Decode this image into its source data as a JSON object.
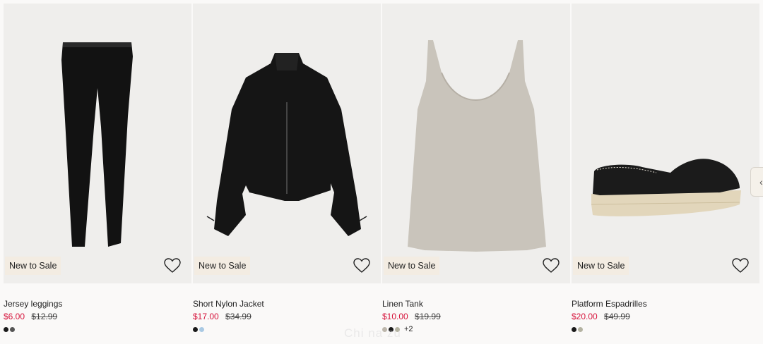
{
  "products": [
    {
      "badge": "New to Sale",
      "name": "Jersey leggings",
      "sale_price": "$6.00",
      "original_price": "$12.99",
      "swatches": [
        "#1a1a1a",
        "#555555"
      ],
      "more_colors": "",
      "image_icon": "leggings-image"
    },
    {
      "badge": "New to Sale",
      "name": "Short Nylon Jacket",
      "sale_price": "$17.00",
      "original_price": "$34.99",
      "swatches": [
        "#1a1a1a",
        "#a9c9e3"
      ],
      "more_colors": "",
      "image_icon": "jacket-image"
    },
    {
      "badge": "New to Sale",
      "name": "Linen Tank",
      "sale_price": "$10.00",
      "original_price": "$19.99",
      "swatches": [
        "#bdb7ac",
        "#1a1a1a",
        "#b4b3a2"
      ],
      "more_colors": "+2",
      "image_icon": "tank-top-image"
    },
    {
      "badge": "New to Sale",
      "name": "Platform Espadrilles",
      "sale_price": "$20.00",
      "original_price": "$49.99",
      "swatches": [
        "#1a1a1a",
        "#b4b3a2"
      ],
      "more_colors": "",
      "image_icon": "espadrilles-image"
    }
  ],
  "carousel": {
    "next_icon": "chevron-right-icon",
    "next_glyph": "‹"
  },
  "watermark": "Chi na zu",
  "colors": {
    "sale_red": "#d6133b",
    "badge_bg": "#f3ece2",
    "image_bg": "#efeeec"
  }
}
